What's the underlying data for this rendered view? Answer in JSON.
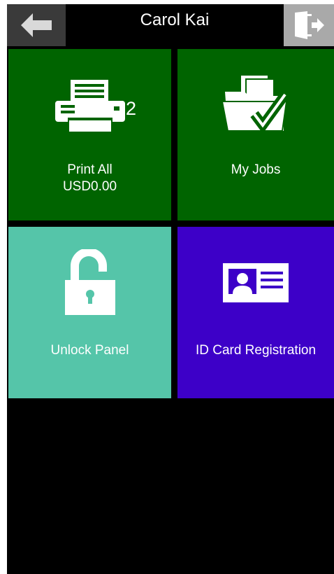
{
  "header": {
    "title": "Carol Kai",
    "back_icon": "arrow-left-icon",
    "logout_icon": "logout-door-icon"
  },
  "tiles": [
    {
      "label_line1": "Print All",
      "label_line2": "USD0.00",
      "count": "2",
      "icon": "printer-icon",
      "color": "#006400"
    },
    {
      "label_line1": "My Jobs",
      "icon": "folder-check-icon",
      "color": "#006400"
    },
    {
      "label_line1": "Unlock Panel",
      "icon": "padlock-open-icon",
      "color": "#55c5a9"
    },
    {
      "label_line1": "ID Card Registration",
      "icon": "id-card-icon",
      "color": "#3d00c8"
    }
  ],
  "colors": {
    "header_back_bg": "#3a3a3a",
    "header_logout_bg": "#a9a9a9",
    "background": "#000000"
  }
}
